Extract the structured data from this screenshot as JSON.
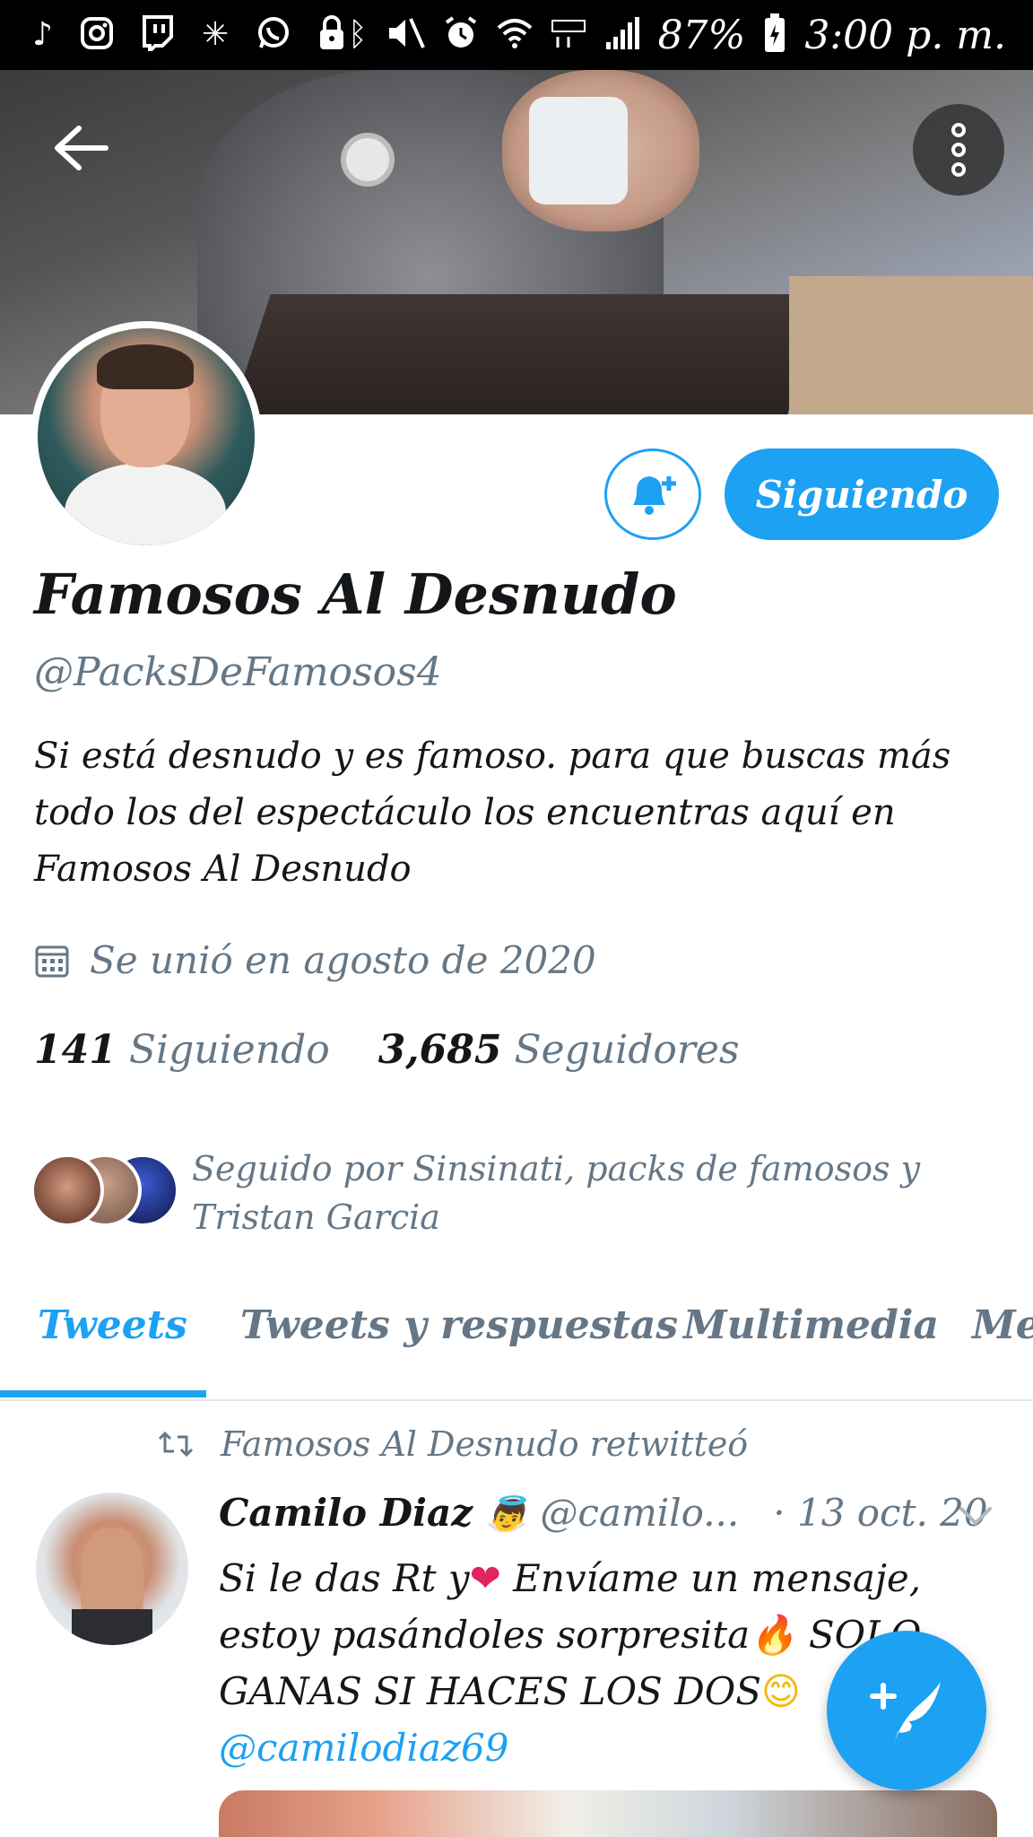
{
  "status_bar": {
    "left_icons": [
      "tiktok-icon",
      "instagram-icon",
      "twitch-icon",
      "sparkle-icon",
      "whatsapp-icon",
      "lock-icon"
    ],
    "right_icons": [
      "bluetooth-icon",
      "mute-icon",
      "alarm-icon",
      "wifi-icon",
      "lte-icon",
      "signal-icon",
      "battery-icon"
    ],
    "battery": "87%",
    "time": "3:00 p. m."
  },
  "profile": {
    "name": "Famosos Al Desnudo",
    "handle": "@PacksDeFamosos4",
    "bio": "Si está desnudo y es famoso. para que buscas más todo los del espectáculo los encuentras aquí en Famosos Al Desnudo",
    "joined": "Se unió en agosto de 2020",
    "following_count": "141",
    "following_label": "Siguiendo",
    "followers_count": "3,685",
    "followers_label": "Seguidores",
    "followed_by": "Seguido por Sinsinati, packs de famosos y Tristan Garcia",
    "follow_button": "Siguiendo"
  },
  "tabs": [
    {
      "label": "Tweets",
      "active": true
    },
    {
      "label": "Tweets y respuestas",
      "active": false
    },
    {
      "label": "Multimedia",
      "active": false
    },
    {
      "label": "Me",
      "active": false
    }
  ],
  "tweet": {
    "retweet_context": "Famosos Al Desnudo retwitteó",
    "author_name": "Camilo Diaz",
    "author_emoji": "👼",
    "author_handle": "@camilo...",
    "date": "· 13 oct. 20",
    "text_part1": "Si le das Rt y",
    "heart": "❤",
    "text_part2": " Envíame un mensaje, estoy pasándoles sorpresita",
    "fire": "🔥",
    "text_part3": " SOLO GANAS SI HACES LOS DOS",
    "smile": "😊",
    "mention": "@camilodiaz69"
  },
  "colors": {
    "accent": "#1da1f2",
    "secondary_text": "#657786",
    "primary_text": "#14171a"
  }
}
